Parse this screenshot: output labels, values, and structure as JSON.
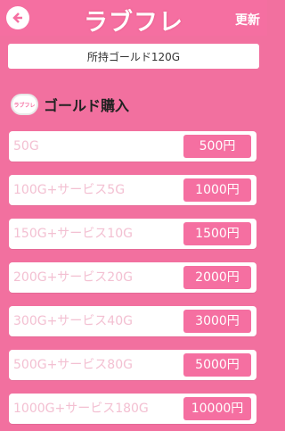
{
  "header": {
    "logo": "ラブフレ",
    "refresh_label": "更新"
  },
  "gold": {
    "text": "所持ゴールド120G"
  },
  "section": {
    "icon_text": "ラブフレ",
    "title": "ゴールド購入"
  },
  "packages": [
    {
      "label": "50G",
      "price": "500円"
    },
    {
      "label": "100G+サービス5G",
      "price": "1000円"
    },
    {
      "label": "150G+サービス10G",
      "price": "1500円"
    },
    {
      "label": "200G+サービス20G",
      "price": "2000円"
    },
    {
      "label": "300G+サービス40G",
      "price": "3000円"
    },
    {
      "label": "500G+サービス80G",
      "price": "5000円"
    },
    {
      "label": "1000G+サービス180G",
      "price": "10000円"
    }
  ],
  "colors": {
    "background": "#f2709f",
    "accent": "#f56fa1",
    "label": "#f3c0d2"
  }
}
